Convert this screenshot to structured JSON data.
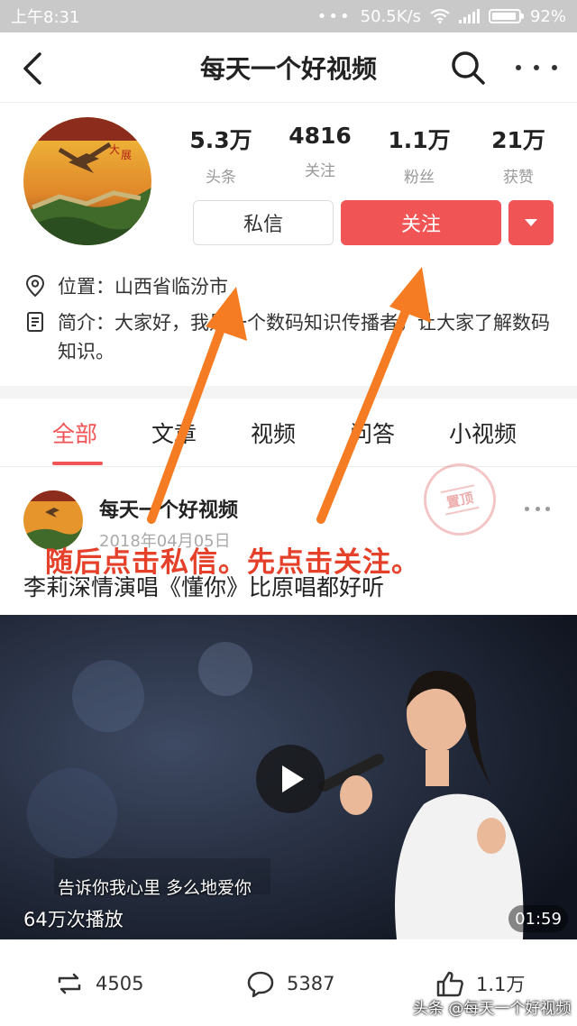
{
  "status_bar": {
    "time": "上午8:31",
    "dots": "•••",
    "speed": "50.5K/s",
    "battery": "92%",
    "battery_level": 0.92
  },
  "nav": {
    "title": "每天一个好视频",
    "back_icon": "back-arrow-icon",
    "search_icon": "search-icon",
    "more_icon": "more-dots-icon"
  },
  "profile": {
    "stats": [
      {
        "value": "5.3万",
        "label": "头条"
      },
      {
        "value": "4816",
        "label": "关注"
      },
      {
        "value": "1.1万",
        "label": "粉丝"
      },
      {
        "value": "21万",
        "label": "获赞"
      }
    ],
    "message_button": "私信",
    "follow_button": "关注",
    "location": "位置：山西省临汾市",
    "bio": "简介：大家好，我是一个数码知识传播者，让大家了解数码知识。"
  },
  "tabs": [
    "全部",
    "文章",
    "视频",
    "问答",
    "小视频"
  ],
  "post": {
    "author": "每天一个好视频",
    "date": "2018年04月05日",
    "stamp": "置顶",
    "title": "李莉深情演唱《懂你》比原唱都好听",
    "video": {
      "subtitle": "告诉你我心里 多么地爱你",
      "plays": "64万次播放",
      "duration": "01:59"
    },
    "actions": {
      "repost": "4505",
      "comment": "5387",
      "like": "1.1万"
    }
  },
  "annotation": "随后点击私信。先点击关注。",
  "watermark": "头条 @每天一个好视频",
  "colors": {
    "accent": "#f05454",
    "annotation": "#e4402a",
    "arrow": "#f57c22"
  }
}
